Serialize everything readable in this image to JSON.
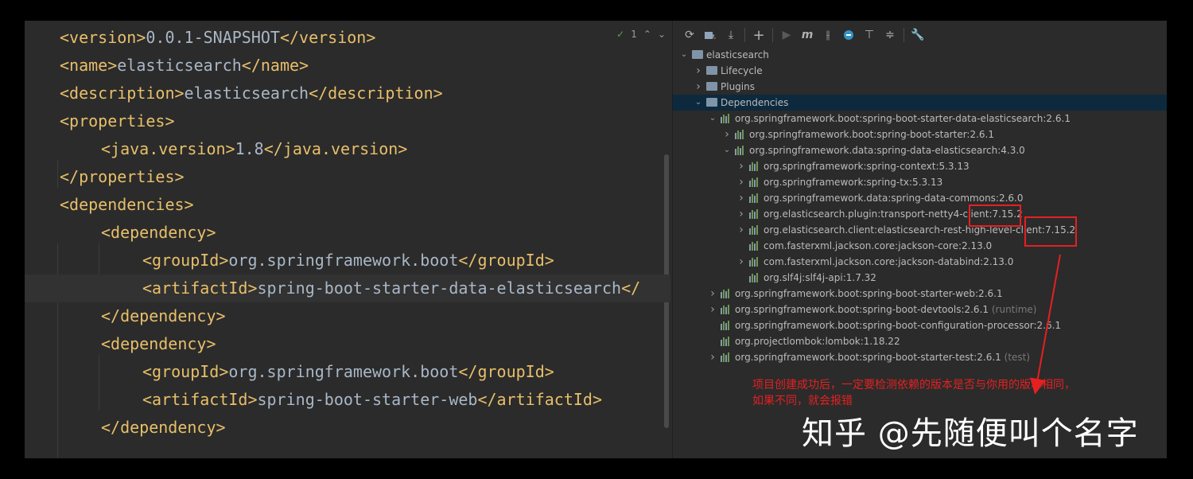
{
  "editor": {
    "inspection_count": "1",
    "lines": [
      {
        "indent": 1,
        "parts": [
          [
            "tag",
            "<version>"
          ],
          [
            "txt",
            "0.0.1-SNAPSHOT"
          ],
          [
            "tag",
            "</version>"
          ]
        ]
      },
      {
        "indent": 1,
        "parts": [
          [
            "tag",
            "<name>"
          ],
          [
            "txt",
            "elasticsearch"
          ],
          [
            "tag",
            "</name>"
          ]
        ]
      },
      {
        "indent": 1,
        "parts": [
          [
            "tag",
            "<description>"
          ],
          [
            "txt",
            "elasticsearch"
          ],
          [
            "tag",
            "</description>"
          ]
        ]
      },
      {
        "indent": 1,
        "parts": [
          [
            "tag",
            "<properties>"
          ]
        ]
      },
      {
        "indent": 2,
        "parts": [
          [
            "tag",
            "<java.version>"
          ],
          [
            "txt",
            "1.8"
          ],
          [
            "tag",
            "</java.version>"
          ]
        ]
      },
      {
        "indent": 1,
        "parts": [
          [
            "tag",
            "</properties>"
          ]
        ]
      },
      {
        "indent": 1,
        "parts": [
          [
            "tag",
            "<dependencies>"
          ]
        ]
      },
      {
        "indent": 2,
        "parts": [
          [
            "tag",
            "<dependency>"
          ]
        ]
      },
      {
        "indent": 3,
        "parts": [
          [
            "tag",
            "<groupId>"
          ],
          [
            "txt",
            "org.springframework.boot"
          ],
          [
            "tag",
            "</groupId>"
          ]
        ]
      },
      {
        "indent": 3,
        "parts": [
          [
            "tag",
            "<artifactId>"
          ],
          [
            "txt",
            "spring-boot-starter-data-elasticsearch"
          ],
          [
            "tag",
            "</"
          ]
        ]
      },
      {
        "indent": 2,
        "parts": [
          [
            "tag",
            "</dependency>"
          ]
        ]
      },
      {
        "indent": 2,
        "parts": [
          [
            "tag",
            "<dependency>"
          ]
        ]
      },
      {
        "indent": 3,
        "parts": [
          [
            "tag",
            "<groupId>"
          ],
          [
            "txt",
            "org.springframework.boot"
          ],
          [
            "tag",
            "</groupId>"
          ]
        ]
      },
      {
        "indent": 3,
        "parts": [
          [
            "tag",
            "<artifactId>"
          ],
          [
            "txt",
            "spring-boot-starter-web"
          ],
          [
            "tag",
            "</artifactId>"
          ]
        ]
      },
      {
        "indent": 2,
        "parts": [
          [
            "tag",
            "</dependency>"
          ]
        ]
      }
    ]
  },
  "maven": {
    "toolbar_icons": [
      "refresh-icon",
      "reimport-icon",
      "download-icon",
      "add-icon",
      "run-icon",
      "maven-goal-icon",
      "toggle-offline-icon",
      "skip-tests-icon",
      "show-dependencies-icon",
      "collapse-icon",
      "settings-icon"
    ],
    "tree": [
      {
        "level": 0,
        "arrow": "down",
        "icon": "folder",
        "label": "elasticsearch",
        "scope": ""
      },
      {
        "level": 1,
        "arrow": "right",
        "icon": "folder",
        "label": "Lifecycle",
        "scope": ""
      },
      {
        "level": 1,
        "arrow": "right",
        "icon": "folder",
        "label": "Plugins",
        "scope": ""
      },
      {
        "level": 1,
        "arrow": "down",
        "icon": "folder",
        "label": "Dependencies",
        "scope": "",
        "selected": true
      },
      {
        "level": 2,
        "arrow": "down",
        "icon": "dep",
        "label": "org.springframework.boot:spring-boot-starter-data-elasticsearch:2.6.1",
        "scope": ""
      },
      {
        "level": 3,
        "arrow": "right",
        "icon": "dep",
        "label": "org.springframework.boot:spring-boot-starter:2.6.1",
        "scope": ""
      },
      {
        "level": 3,
        "arrow": "down",
        "icon": "dep",
        "label": "org.springframework.data:spring-data-elasticsearch:4.3.0",
        "scope": ""
      },
      {
        "level": 4,
        "arrow": "right",
        "icon": "dep",
        "label": "org.springframework:spring-context:5.3.13",
        "scope": ""
      },
      {
        "level": 4,
        "arrow": "right",
        "icon": "dep",
        "label": "org.springframework:spring-tx:5.3.13",
        "scope": ""
      },
      {
        "level": 4,
        "arrow": "right",
        "icon": "dep",
        "label": "org.springframework.data:spring-data-commons:2.6.0",
        "scope": ""
      },
      {
        "level": 4,
        "arrow": "right",
        "icon": "dep",
        "label": "org.elasticsearch.plugin:transport-netty4-client:7.15.2",
        "scope": ""
      },
      {
        "level": 4,
        "arrow": "right",
        "icon": "dep",
        "label": "org.elasticsearch.client:elasticsearch-rest-high-level-client:7.15.2",
        "scope": ""
      },
      {
        "level": 4,
        "arrow": "none",
        "icon": "dep",
        "label": "com.fasterxml.jackson.core:jackson-core:2.13.0",
        "scope": ""
      },
      {
        "level": 4,
        "arrow": "right",
        "icon": "dep",
        "label": "com.fasterxml.jackson.core:jackson-databind:2.13.0",
        "scope": ""
      },
      {
        "level": 4,
        "arrow": "none",
        "icon": "dep",
        "label": "org.slf4j:slf4j-api:1.7.32",
        "scope": ""
      },
      {
        "level": 2,
        "arrow": "right",
        "icon": "dep",
        "label": "org.springframework.boot:spring-boot-starter-web:2.6.1",
        "scope": ""
      },
      {
        "level": 2,
        "arrow": "right",
        "icon": "dep",
        "label": "org.springframework.boot:spring-boot-devtools:2.6.1",
        "scope": "(runtime)"
      },
      {
        "level": 2,
        "arrow": "none",
        "icon": "dep",
        "label": "org.springframework.boot:spring-boot-configuration-processor:2.6.1",
        "scope": ""
      },
      {
        "level": 2,
        "arrow": "none",
        "icon": "dep",
        "label": "org.projectlombok:lombok:1.18.22",
        "scope": ""
      },
      {
        "level": 2,
        "arrow": "right",
        "icon": "dep",
        "label": "org.springframework.boot:spring-boot-starter-test:2.6.1",
        "scope": "(test)"
      }
    ]
  },
  "annotation": {
    "line1": "项目创建成功后，一定要检测依赖的版本是否与你用的版本相同，",
    "line2": "如果不同，就会报错"
  },
  "watermark": "知乎 @先随便叫个名字",
  "colors": {
    "annotation_red": "#e52020",
    "tag": "#e8bf6a",
    "text": "#a9b7c6",
    "selection": "#0d293e"
  }
}
